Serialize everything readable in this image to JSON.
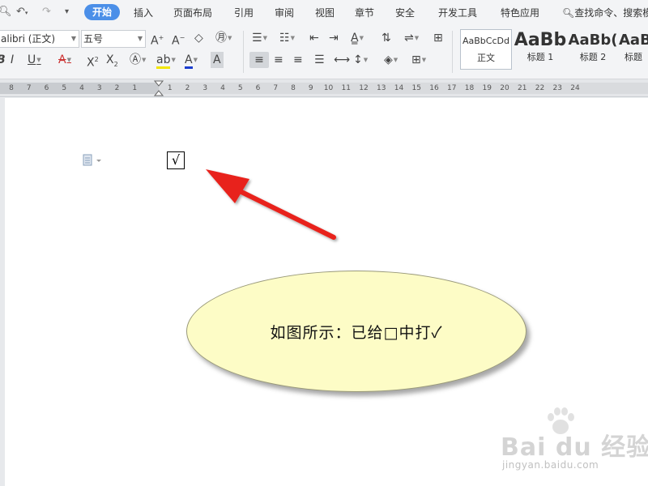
{
  "menu": {
    "tabs": [
      "开始",
      "插入",
      "页面布局",
      "引用",
      "审阅",
      "视图",
      "章节",
      "安全",
      "开发工具",
      "特色应用"
    ],
    "active_tab": "开始",
    "search_text": "查找命令、搜索模"
  },
  "ribbon": {
    "font_name": "alibri (正文)",
    "font_size": "五号",
    "styles": [
      {
        "sample": "AaBbCcDd",
        "name": "正文"
      },
      {
        "sample": "AaBb",
        "name": "标题 1"
      },
      {
        "sample": "AaBb(",
        "name": "标题 2"
      },
      {
        "sample": "AaB",
        "name": "标题"
      }
    ],
    "accent_color": "#4b8fe8",
    "highlight_color": "#f2e500",
    "font_color": "#1a3dcf"
  },
  "ruler": {
    "ticks": [
      "8",
      "7",
      "6",
      "5",
      "4",
      "3",
      "2",
      "1",
      "",
      "1",
      "2",
      "3",
      "4",
      "5",
      "6",
      "7",
      "8",
      "9",
      "10",
      "11",
      "12",
      "13",
      "14",
      "15",
      "16",
      "17",
      "18",
      "19",
      "20",
      "21",
      "22",
      "23",
      "24"
    ]
  },
  "document": {
    "checkbox_char": "√",
    "callout_text": "如图所示：已给□中打✓"
  },
  "watermark": {
    "main": "Bai du 经验",
    "sub": "jingyan.baidu.com"
  }
}
